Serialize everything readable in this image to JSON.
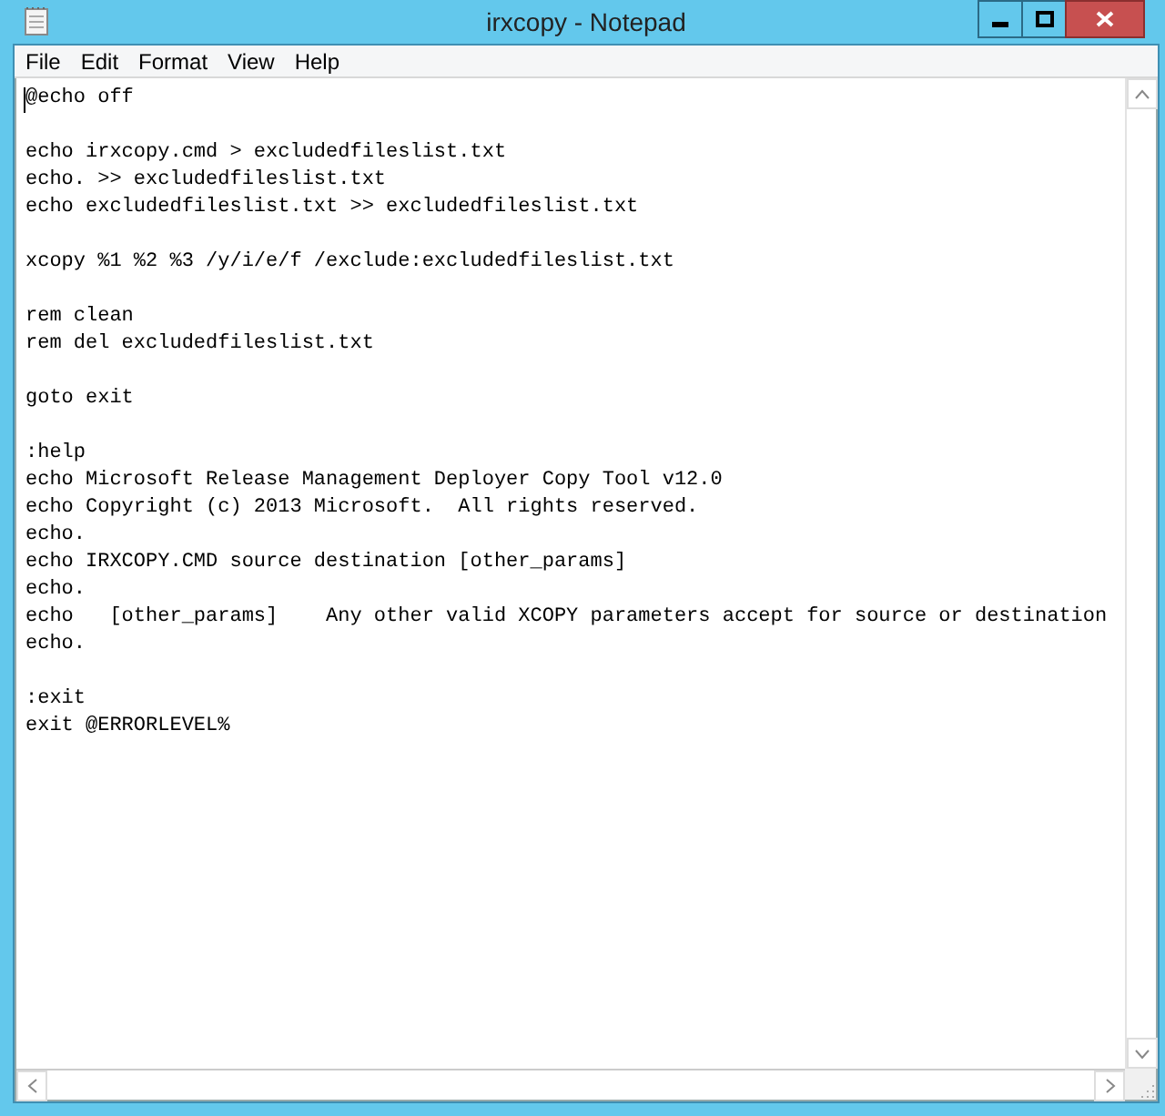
{
  "window": {
    "title": "irxcopy - Notepad"
  },
  "menu": [
    "File",
    "Edit",
    "Format",
    "View",
    "Help"
  ],
  "editor": {
    "text": "@echo off\n\necho irxcopy.cmd > excludedfileslist.txt\necho. >> excludedfileslist.txt\necho excludedfileslist.txt >> excludedfileslist.txt\n\nxcopy %1 %2 %3 /y/i/e/f /exclude:excludedfileslist.txt\n\nrem clean\nrem del excludedfileslist.txt\n\ngoto exit\n\n:help\necho Microsoft Release Management Deployer Copy Tool v12.0\necho Copyright (c) 2013 Microsoft.  All rights reserved.\necho.\necho IRXCOPY.CMD source destination [other_params]\necho.\necho   [other_params]    Any other valid XCOPY parameters accept for source or destination\necho.\n\n:exit\nexit @ERRORLEVEL%"
  }
}
